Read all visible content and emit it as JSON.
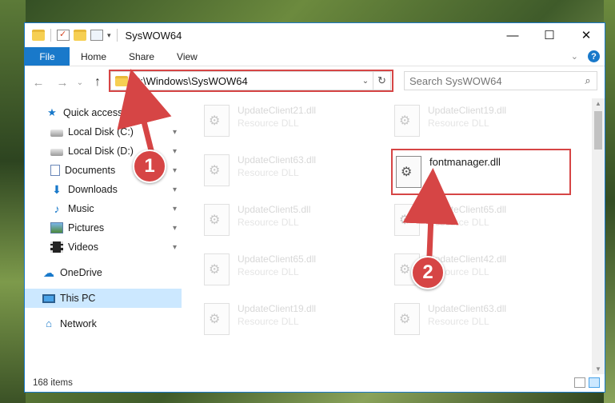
{
  "window": {
    "title": "SysWOW64",
    "controls": {
      "minimize": "—",
      "maximize": "☐",
      "close": "✕"
    }
  },
  "ribbon": {
    "tabs": [
      "File",
      "Home",
      "Share",
      "View"
    ],
    "expand": "⌄",
    "help": "?"
  },
  "nav": {
    "back": "←",
    "forward": "→",
    "recent": "⌄",
    "up": "↑",
    "address": "C:\\Windows\\SysWOW64",
    "address_dropdown": "⌄",
    "refresh": "↻",
    "search_placeholder": "Search SysWOW64",
    "search_icon": "⌕"
  },
  "sidebar": {
    "items": [
      {
        "label": "Quick access",
        "icon": "star-icon",
        "pinned": false
      },
      {
        "label": "Local Disk (C:)",
        "icon": "drive-icon",
        "pinned": true
      },
      {
        "label": "Local Disk (D:)",
        "icon": "drive-icon",
        "pinned": true
      },
      {
        "label": "Documents",
        "icon": "document-icon",
        "pinned": true
      },
      {
        "label": "Downloads",
        "icon": "download-icon",
        "pinned": true
      },
      {
        "label": "Music",
        "icon": "music-icon",
        "pinned": true
      },
      {
        "label": "Pictures",
        "icon": "picture-icon",
        "pinned": true
      },
      {
        "label": "Videos",
        "icon": "video-icon",
        "pinned": true
      },
      {
        "label": "OneDrive",
        "icon": "cloud-icon",
        "pinned": false
      },
      {
        "label": "This PC",
        "icon": "computer-icon",
        "pinned": false,
        "selected": true
      },
      {
        "label": "Network",
        "icon": "network-icon",
        "pinned": false
      }
    ],
    "pin_glyph": "📌"
  },
  "files": [
    {
      "name": "UpdateClient21.dll",
      "type": "Resource DLL"
    },
    {
      "name": "UpdateClient19.dll",
      "type": "Resource DLL"
    },
    {
      "name": "UpdateClient63.dll",
      "type": "Resource DLL"
    },
    {
      "name": "fontmanager.dll",
      "type": "",
      "highlighted": true
    },
    {
      "name": "UpdateClient5.dll",
      "type": "Resource DLL"
    },
    {
      "name": "UpdateClient65.dll",
      "type": "Resource DLL"
    },
    {
      "name": "UpdateClient65.dll",
      "type": "Resource DLL"
    },
    {
      "name": "UpdateClient42.dll",
      "type": "Resource DLL"
    },
    {
      "name": "UpdateClient19.dll",
      "type": "Resource DLL"
    },
    {
      "name": "UpdateClient63.dll",
      "type": "Resource DLL"
    }
  ],
  "status": {
    "item_count": "168 items"
  },
  "annotations": {
    "step1": "1",
    "step2": "2",
    "color": "#d64545"
  },
  "colors": {
    "accent": "#1979ca",
    "selection": "#cce8ff",
    "annotation": "#d64545"
  }
}
